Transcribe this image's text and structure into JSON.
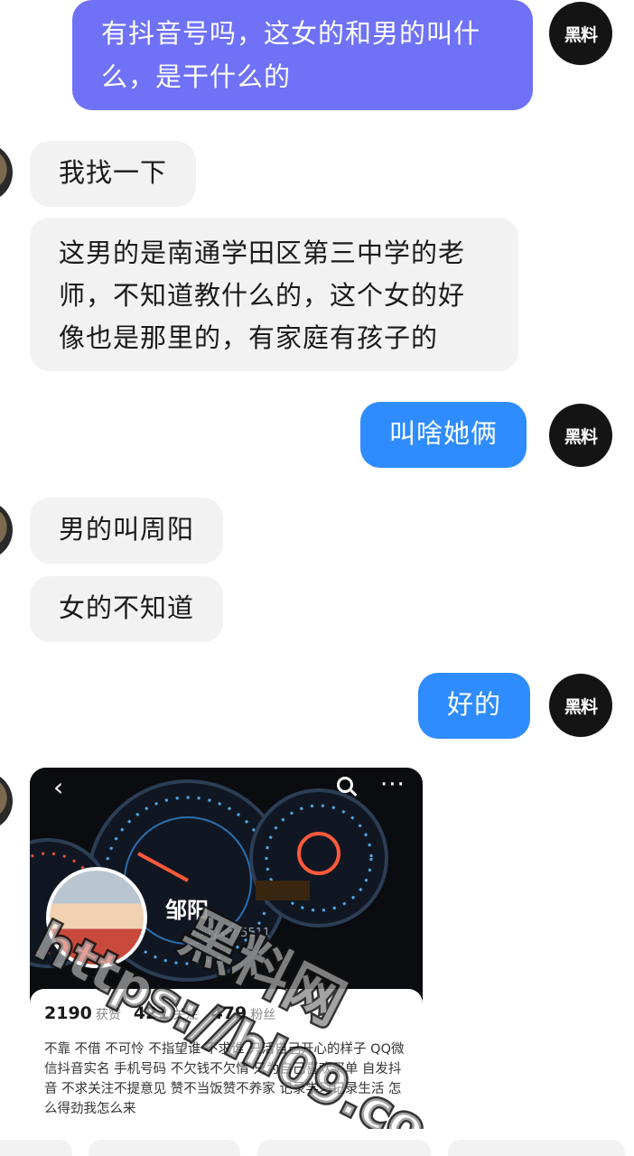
{
  "self_avatar_text": "黑料",
  "colors": {
    "outgoing_purple": "#6F72F6",
    "outgoing_blue": "#2F8CFF",
    "incoming": "#F2F2F2"
  },
  "messages": [
    {
      "id": "m1",
      "direction": "outgoing",
      "text": "有抖音号吗，这女的和男的叫什么，是干什么的"
    },
    {
      "id": "m2",
      "direction": "incoming",
      "text": "我找一下"
    },
    {
      "id": "m3",
      "direction": "incoming",
      "text": "这男的是南通学田区第三中学的老师，不知道教什么的，这个女的好像也是那里的，有家庭有孩子的"
    },
    {
      "id": "m4",
      "direction": "outgoing",
      "text": "叫啥她俩"
    },
    {
      "id": "m5",
      "direction": "incoming",
      "text": "男的叫周阳"
    },
    {
      "id": "m6",
      "direction": "incoming",
      "text": "女的不知道"
    },
    {
      "id": "m7",
      "direction": "outgoing",
      "text": "好的"
    }
  ],
  "profile_card": {
    "name": "邹阳",
    "handle": "zouyang5511",
    "stats": [
      {
        "value": "2190",
        "label": "获赞"
      },
      {
        "value": "421",
        "label": "关注"
      },
      {
        "value": "479",
        "label": "粉丝"
      }
    ],
    "bio": "不靠 不借 不可怜 不指望谁 不求谁 只活自己开心的样子 QQ微信抖音实名 手机号码 不欠钱不欠情 只为自己喜欢买单 自发抖音 不求关注不提意见 赞不当饭赞不养家 记录学习记录生活 怎么得劲我怎么来"
  },
  "watermark": {
    "brand": "黑料网",
    "url": "https://hl09.co"
  }
}
